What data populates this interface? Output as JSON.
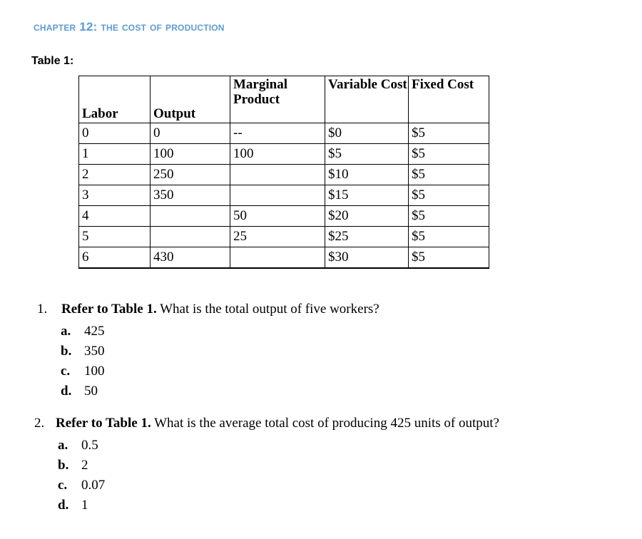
{
  "document": {
    "chapter_header": "Chapter 12: The Cost of Production",
    "table_caption": "Table 1:"
  },
  "table": {
    "columns": [
      "Labor",
      "Output",
      "Marginal Product",
      "Variable Cost",
      "Fixed Cost"
    ],
    "rows": [
      [
        "0",
        "0",
        "--",
        "$0",
        "$5"
      ],
      [
        "1",
        "100",
        "100",
        "$5",
        "$5"
      ],
      [
        "2",
        "250",
        "",
        "$10",
        "$5"
      ],
      [
        "3",
        "350",
        "",
        "$15",
        "$5"
      ],
      [
        "4",
        "",
        "50",
        "$20",
        "$5"
      ],
      [
        "5",
        "",
        "25",
        "$25",
        "$5"
      ],
      [
        "6",
        "430",
        "",
        "$30",
        "$5"
      ]
    ]
  },
  "questions": [
    {
      "number": "1.",
      "lead": "Refer to Table 1.",
      "rest": " What is the total output of five workers?",
      "options": [
        {
          "letter": "a.",
          "value": "425"
        },
        {
          "letter": "b.",
          "value": "350"
        },
        {
          "letter": "c.",
          "value": "100"
        },
        {
          "letter": "d.",
          "value": "50"
        }
      ]
    },
    {
      "number": "2.",
      "lead": "Refer to Table 1.",
      "rest": " What is the average total cost of producing 425 units of output?",
      "options": [
        {
          "letter": "a.",
          "value": "0.5"
        },
        {
          "letter": "b.",
          "value": "2"
        },
        {
          "letter": "c.",
          "value": "0.07"
        },
        {
          "letter": "d.",
          "value": "1"
        }
      ]
    }
  ],
  "colors": {
    "header_blue": "#5b9bd5",
    "text_black": "#000000",
    "page_background": "#ffffff"
  }
}
